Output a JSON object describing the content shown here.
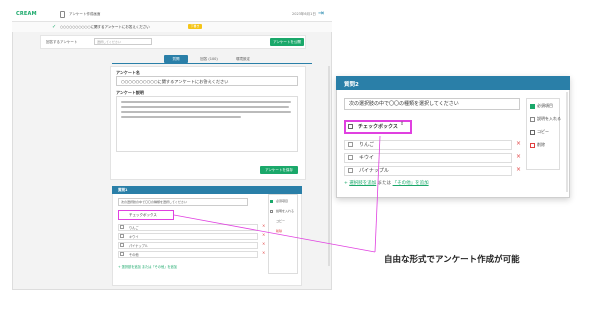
{
  "app": {
    "logo": "CREAM",
    "title": "アンケート作成画面",
    "date": "2023年6月1日",
    "notice_text": "○○○○○○○○○○に関するアンケートにお答えください",
    "notice_badge": "下書き"
  },
  "filter": {
    "label": "回答するアンケート",
    "select_value": "選択してください",
    "publish_button": "アンケートを公開"
  },
  "tabs": [
    {
      "label": "質問"
    },
    {
      "label": "回答 (100)"
    },
    {
      "label": "環境設定"
    }
  ],
  "edit": {
    "title_label": "アンケート名",
    "title_value": "○○○○○○○○○○に関するアンケートにお答えください",
    "desc_label": "アンケート説明",
    "save_button": "アンケートを保存"
  },
  "question_small": {
    "header": "質問1",
    "question_text": "次の選択肢の中で〇〇の種類を選択してください",
    "type": "チェックボックス",
    "options": [
      "りんご",
      "キウイ",
      "パイナップル",
      "その他"
    ],
    "add_option": "+ 選択肢を追加 または「その他」を追加",
    "side": {
      "required": "必須項目",
      "explain": "説明を入れる",
      "copy": "コピー",
      "delete": "削除"
    }
  },
  "question_zoom": {
    "header": "質問2",
    "question_text": "次の選択肢の中で〇〇の種類を選択してください",
    "type": "チェックボックス",
    "options": [
      "りんご",
      "キウイ",
      "パイナップル"
    ],
    "add_prefix": "+",
    "add_link": "選択肢を追加",
    "add_middle": "または",
    "add_other": "「その他」を追加",
    "side": {
      "required": "必須項目",
      "explain": "説明を入れる",
      "copy": "コピー",
      "delete": "削除"
    }
  },
  "caption": "自由な形式でアンケート作成が可能",
  "colors": {
    "accent": "#1aa86a",
    "header": "#2a7fa8",
    "highlight": "#e040e0",
    "delete": "#e04040"
  }
}
